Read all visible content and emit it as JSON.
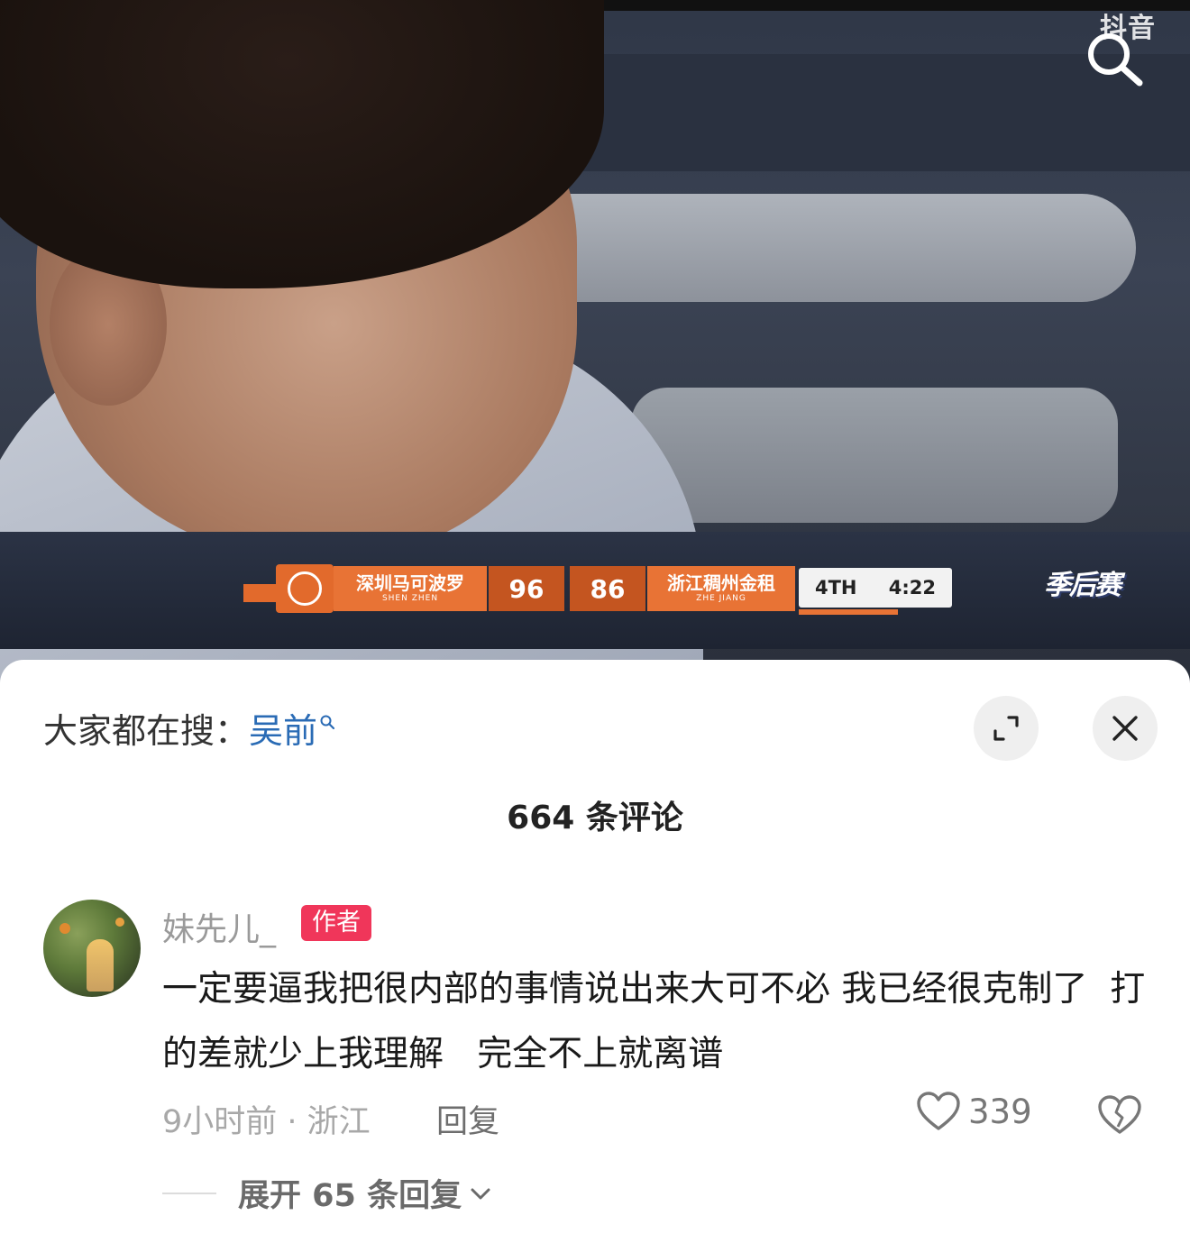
{
  "video": {
    "brand_watermark": "抖音",
    "scoreboard": {
      "home_team": "深圳马可波罗",
      "home_pinyin": "SHEN ZHEN",
      "home_score": "96",
      "away_score": "86",
      "away_team": "浙江稠州金租",
      "away_pinyin": "ZHE JIANG",
      "quarter": "4TH",
      "clock": "4:22"
    },
    "playoff_logo": "季后赛",
    "icons": {
      "search": "search-icon"
    }
  },
  "sheet": {
    "hot_search_prefix": "大家都在搜：",
    "hot_search_keyword": "吴前",
    "comment_count_title": "664 条评论",
    "icons": {
      "expand": "expand-icon",
      "close": "close-icon"
    }
  },
  "comment": {
    "username": "妹先儿_",
    "badge": "作者",
    "text": "一定要逼我把很内部的事情说出来大可不必 我已经很克制了  打的差就少上我理解   完全不上就离谱",
    "meta": "9小时前 · 浙江",
    "reply_label": "回复",
    "like_count": "339",
    "expand_replies": "展开 65 条回复"
  },
  "colors": {
    "keyword_blue": "#2a6bb5",
    "badge_red": "#f0365a",
    "scoreboard_orange": "#e87335"
  }
}
